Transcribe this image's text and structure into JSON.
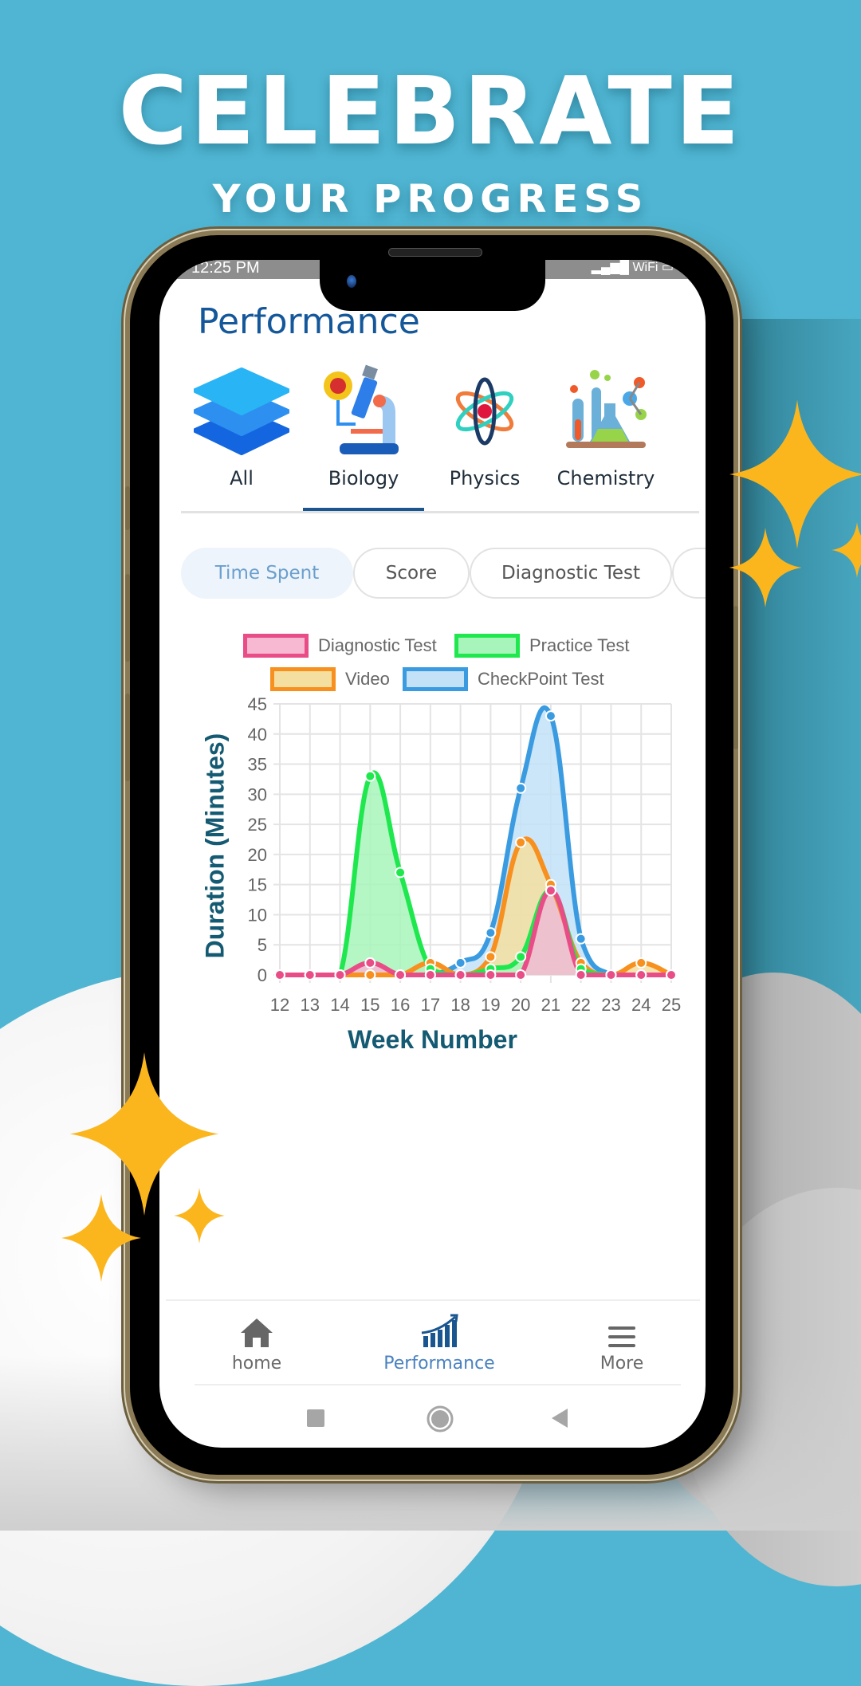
{
  "banner": {
    "headline": "CELEBRATE",
    "subheadline": "YOUR PROGRESS"
  },
  "status_bar": {
    "time": "12:25 PM",
    "network": "WiFi"
  },
  "page": {
    "title": "Performance"
  },
  "subjects": [
    {
      "label": "All",
      "icon": "layers-icon",
      "selected": false
    },
    {
      "label": "Biology",
      "icon": "microscope-icon",
      "selected": true
    },
    {
      "label": "Physics",
      "icon": "atom-icon",
      "selected": false
    },
    {
      "label": "Chemistry",
      "icon": "lab-flasks-icon",
      "selected": false
    }
  ],
  "metric_chips": [
    {
      "label": "Time Spent",
      "selected": true
    },
    {
      "label": "Score",
      "selected": false
    },
    {
      "label": "Diagnostic Test",
      "selected": false
    }
  ],
  "chart_data": {
    "type": "area",
    "title": "",
    "xlabel": "Week Number",
    "ylabel": "Duration (Minutes)",
    "x": [
      12,
      13,
      14,
      15,
      16,
      17,
      18,
      19,
      20,
      21,
      22,
      23,
      24,
      25
    ],
    "ylim": [
      0,
      45
    ],
    "yticks": [
      0,
      5,
      10,
      15,
      20,
      25,
      30,
      35,
      40,
      45
    ],
    "grid": true,
    "legend_position": "top-center",
    "smooth": true,
    "series": [
      {
        "name": "Diagnostic Test",
        "color": "#e94d87",
        "fill": "#f7b8d1",
        "values": [
          0,
          0,
          0,
          2,
          0,
          0,
          0,
          0,
          0,
          14,
          0,
          0,
          0,
          0
        ]
      },
      {
        "name": "Practice Test",
        "color": "#1fe84f",
        "fill": "#a8f5bb",
        "values": [
          0,
          0,
          0,
          33,
          17,
          1,
          0,
          1,
          3,
          14,
          1,
          0,
          0,
          0
        ]
      },
      {
        "name": "Video",
        "color": "#f7901e",
        "fill": "#f5dfa0",
        "values": [
          0,
          0,
          0,
          0,
          0,
          2,
          0,
          3,
          22,
          15,
          2,
          0,
          2,
          0
        ]
      },
      {
        "name": "CheckPoint Test",
        "color": "#3a9be0",
        "fill": "#c3e2f8",
        "values": [
          0,
          0,
          0,
          0,
          0,
          0,
          2,
          7,
          31,
          43,
          6,
          0,
          0,
          0
        ]
      }
    ]
  },
  "bottom_nav": [
    {
      "label": "home",
      "icon": "home-icon",
      "active": false
    },
    {
      "label": "Performance",
      "icon": "growth-chart-icon",
      "active": true
    },
    {
      "label": "More",
      "icon": "menu-icon",
      "active": false
    }
  ],
  "colors": {
    "background": "#4fb5d2",
    "title_blue": "#14579a",
    "tab_underline": "#1a5590",
    "axis_title": "#145a72",
    "active_nav": "#4a82c0"
  }
}
